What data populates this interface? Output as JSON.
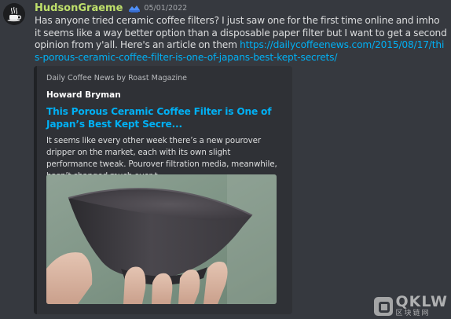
{
  "message": {
    "username": "HudsonGraeme",
    "username_color": "#bfe06b",
    "badge_icon": "hypesquad-badge-icon",
    "timestamp": "05/01/2022",
    "text": "Has anyone tried ceramic coffee filters? I just saw one for the first time online and imho it seems like a way better option than a disposable paper filter but I want to get a second opinion from y'all. Here's an article on them ",
    "link": "https://dailycoffeenews.com/2015/08/17/this-porous-ceramic-coffee-filter-is-one-of-japans-best-kept-secrets/",
    "link_color": "#00b0f4"
  },
  "embed": {
    "provider": "Daily Coffee News by Roast Magazine",
    "author": "Howard Bryman",
    "title": "This Porous Ceramic Coffee Filter is One of Japan’s Best Kept Secre...",
    "description": "It seems like every other week there’s a new pourover dripper on the market, each with its own slight performance tweak. Pourover filtration media, meanwhile, hasn’t changed much over t...",
    "image_alt": "ceramic-coffee-filter-photo"
  },
  "watermark": {
    "brand": "QKLW",
    "sub": "区块链网"
  }
}
